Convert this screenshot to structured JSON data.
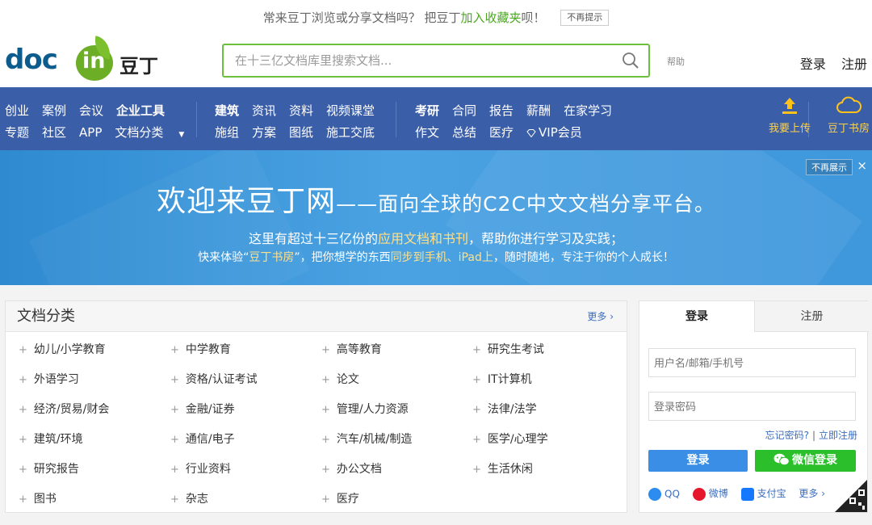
{
  "notice": {
    "text_before": "常来豆丁浏览或分享文档吗？ 把豆丁",
    "highlight": "加入收藏夹",
    "text_after": "呗！",
    "dismiss": "不再提示"
  },
  "header": {
    "logo_doc": "doc",
    "logo_in": "in",
    "logo_cn": "豆丁",
    "search_placeholder": "在十三亿文档库里搜索文档...",
    "help": "帮助",
    "login": "登录",
    "register": "注册"
  },
  "nav": {
    "group1": {
      "row1": [
        "创业",
        "案例",
        "会议",
        "企业工具"
      ],
      "row2": [
        "专题",
        "社区",
        "APP",
        "文档分类"
      ]
    },
    "group2": {
      "row1": [
        "建筑",
        "资讯",
        "资料",
        "视频课堂"
      ],
      "row2": [
        "施组",
        "方案",
        "图纸",
        "施工交底"
      ]
    },
    "group3": {
      "row1": [
        "考研",
        "合同",
        "报告",
        "薪酬",
        "在家学习"
      ],
      "row2": [
        "作文",
        "总结",
        "医疗",
        "VIP会员"
      ]
    },
    "upload": "我要上传",
    "bookroom": "豆丁书房"
  },
  "banner": {
    "title": "欢迎来豆丁网",
    "title_sub": "——面向全球的C2C中文文档分享平台。",
    "line1_a": "这里有超过十三亿份的",
    "line1_b": "应用文档和书刊",
    "line1_c": "，帮助你进行学习及实践；",
    "line2_a": "快来体验“",
    "line2_b": "豆丁书房",
    "line2_c": "”，把你想学的东西",
    "line2_d": "同步到手机、iPad上",
    "line2_e": "，随时随地，专注于你的个人成长！",
    "dismiss": "不再展示",
    "close": "×"
  },
  "categories": {
    "title": "文档分类",
    "more": "更多",
    "items": [
      "幼儿/小学教育",
      "中学教育",
      "高等教育",
      "研究生考试",
      "外语学习",
      "资格/认证考试",
      "论文",
      "IT计算机",
      "经济/贸易/财会",
      "金融/证券",
      "管理/人力资源",
      "法律/法学",
      "建筑/环境",
      "通信/电子",
      "汽车/机械/制造",
      "医学/心理学",
      "研究报告",
      "行业资料",
      "办公文档",
      "生活休闲",
      "图书",
      "杂志",
      "医疗"
    ]
  },
  "login": {
    "tab_login": "登录",
    "tab_register": "注册",
    "username_placeholder": "用户名/邮箱/手机号",
    "password_placeholder": "登录密码",
    "forgot": "忘记密码?",
    "separator": "|",
    "register_now": "立即注册",
    "login_button": "登录",
    "wechat_button": "微信登录",
    "social": [
      "QQ",
      "微博",
      "支付宝",
      "更多"
    ]
  }
}
